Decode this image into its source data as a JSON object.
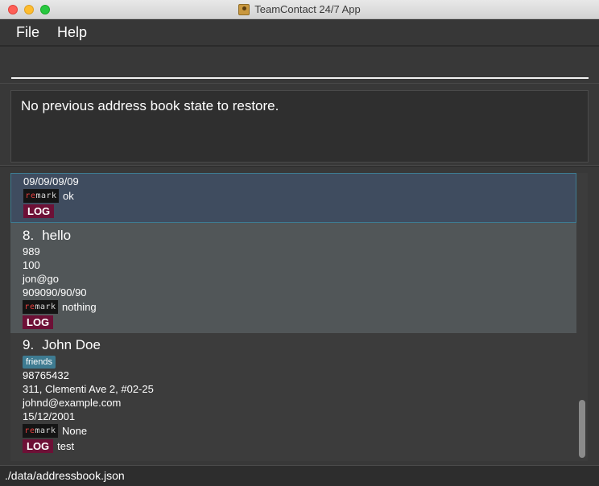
{
  "window": {
    "title": "TeamContact 24/7 App"
  },
  "menu": {
    "file": "File",
    "help": "Help"
  },
  "command": {
    "value": "",
    "placeholder": ""
  },
  "result": {
    "message": "No previous address book state to restore."
  },
  "list": {
    "partial_card": {
      "date": "09/09/09/09",
      "remark": "ok",
      "log_label": "LOG",
      "log_text": ""
    },
    "card8": {
      "index": "8.",
      "name": "hello",
      "phone": "989",
      "address": "100",
      "email": "jon@go",
      "date": "909090/90/90",
      "remark": "nothing",
      "log_label": "LOG",
      "log_text": ""
    },
    "card9": {
      "index": "9.",
      "name": "John Doe",
      "tag": "friends",
      "phone": "98765432",
      "address": "311, Clementi Ave 2, #02-25",
      "email": "johnd@example.com",
      "date": "15/12/2001",
      "remark": "None",
      "log_label": "LOG",
      "log_text": "test"
    },
    "remark_badge": {
      "part1": "re",
      "part2": "mark"
    }
  },
  "status": {
    "path": "./data/addressbook.json"
  },
  "colors": {
    "selected_card": "#3f4c5f",
    "even_card": "#515658",
    "tag": "#3e7b91",
    "log_badge": "#6d1036"
  }
}
